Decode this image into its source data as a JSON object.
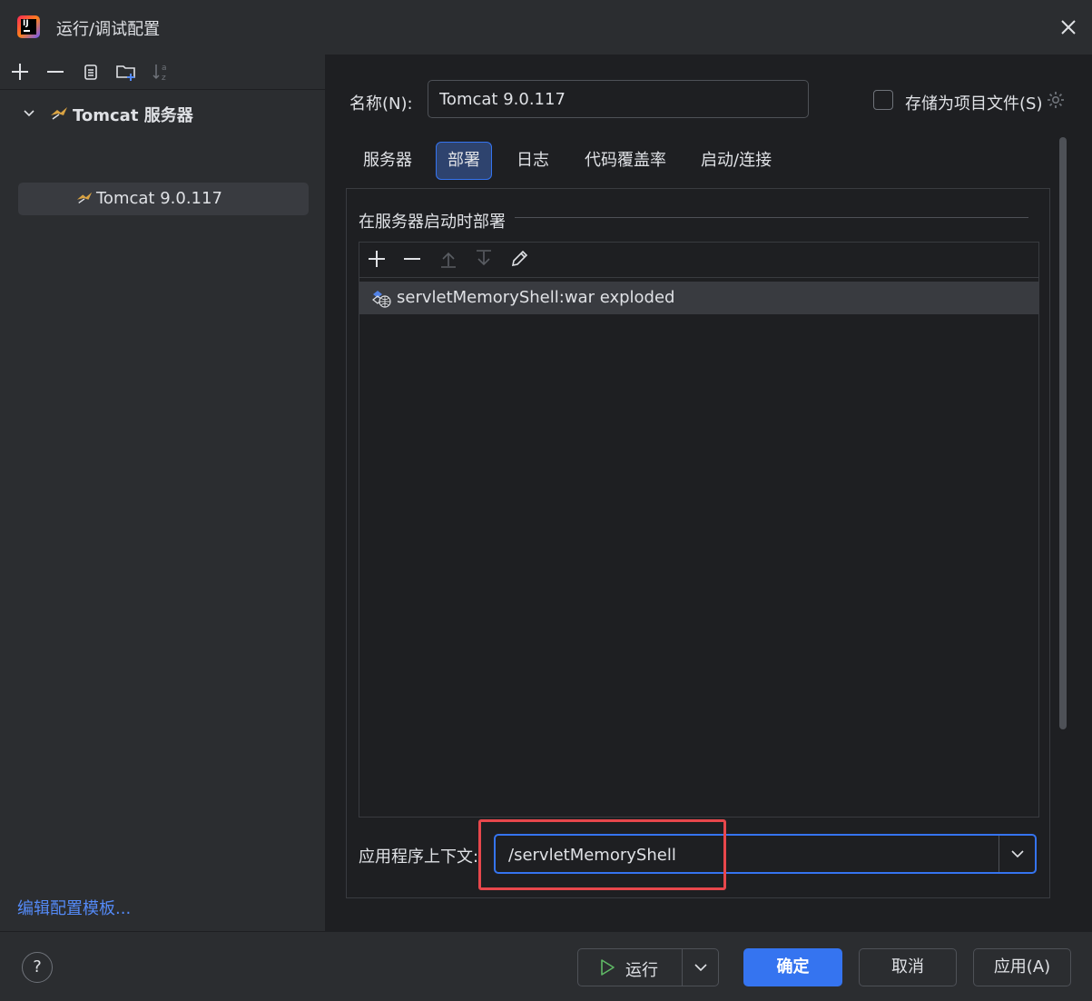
{
  "window": {
    "title": "运行/调试配置"
  },
  "sidebar": {
    "group_label": "Tomcat 服务器",
    "item_label": "Tomcat 9.0.117",
    "edit_templates_link": "编辑配置模板..."
  },
  "config": {
    "name_label": "名称(N):",
    "name_value": "Tomcat 9.0.117",
    "store_checkbox_label": "存储为项目文件(S)",
    "store_checked": false
  },
  "tabs": [
    {
      "label": "服务器",
      "active": false
    },
    {
      "label": "部署",
      "active": true
    },
    {
      "label": "日志",
      "active": false
    },
    {
      "label": "代码覆盖率",
      "active": false
    },
    {
      "label": "启动/连接",
      "active": false
    }
  ],
  "deployment": {
    "section_title": "在服务器启动时部署",
    "artifacts": [
      "servletMemoryShell:war exploded"
    ],
    "context_label": "应用程序上下文:",
    "context_value": "/servletMemoryShell"
  },
  "footer": {
    "help_label": "?",
    "run_label": "运行",
    "ok_label": "确定",
    "cancel_label": "取消",
    "apply_label": "应用(A)"
  },
  "colors": {
    "accent": "#3574f0",
    "highlight_border": "#e8474c",
    "link": "#548af7",
    "run_green": "#5fb865"
  }
}
